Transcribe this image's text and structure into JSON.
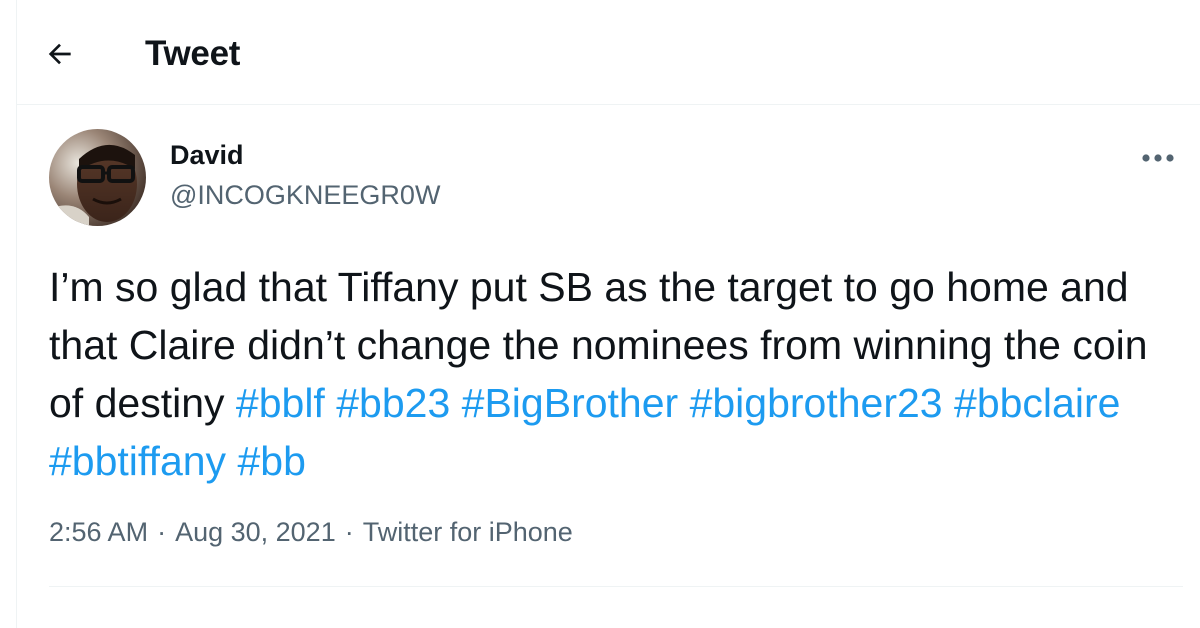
{
  "header": {
    "title": "Tweet",
    "back_icon": "arrow-left-icon"
  },
  "tweet": {
    "author": {
      "name": "David",
      "handle": "@INCOGKNEEGR0W"
    },
    "more_icon": "more-horizontal-icon",
    "text_parts": {
      "plain": "I’m so glad that Tiffany put SB as the target to go home and that Claire didn’t change the nominees from winning the coin of destiny",
      "hashtags": [
        "#bblf",
        "#bb23",
        "#BigBrother",
        "#bigbrother23",
        "#bbclaire",
        "#bbtiffany",
        "#bb"
      ]
    },
    "time": "2:56 AM",
    "date": "Aug 30, 2021",
    "source": "Twitter for iPhone",
    "separator": "·"
  },
  "colors": {
    "hashtag": "#1d9bf0",
    "secondary_text": "#536471",
    "primary_text": "#0f1419",
    "border": "#eff3f4"
  }
}
